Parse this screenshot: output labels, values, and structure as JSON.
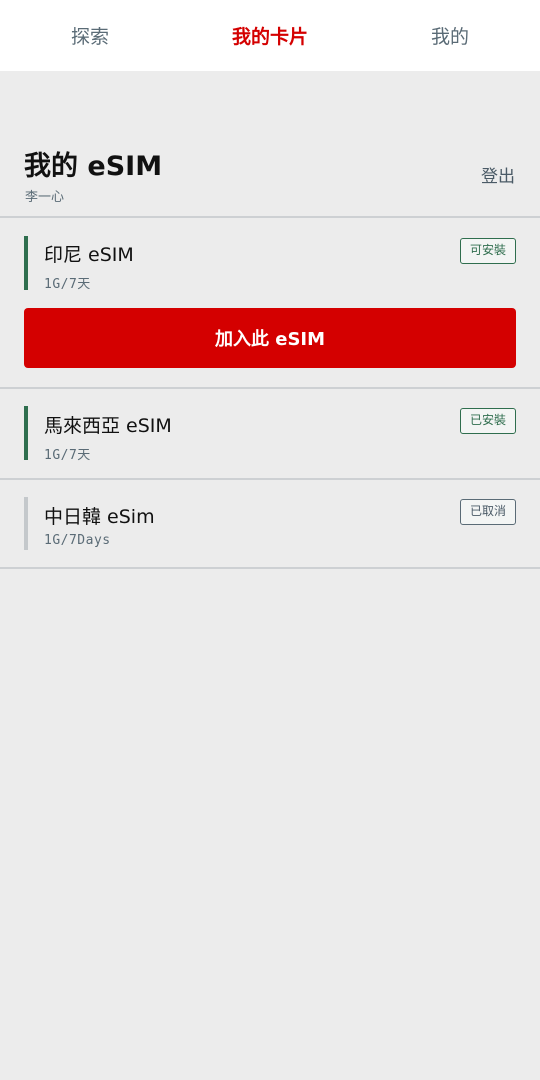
{
  "tabs": [
    {
      "label": "探索"
    },
    {
      "label": "我的卡片"
    },
    {
      "label": "我的"
    }
  ],
  "header": {
    "title": "我的 eSIM",
    "user": "李一心",
    "logout": "登出"
  },
  "cards": [
    {
      "name": "印尼 eSIM",
      "plan": "1G/7天",
      "status": "可安裝"
    },
    {
      "name": "馬來西亞 eSIM",
      "plan": "1G/7天",
      "status": "已安裝"
    },
    {
      "name": "中日韓 eSim",
      "plan": "1G/7Days",
      "status": "已取消"
    }
  ],
  "add_button": "加入此 eSIM",
  "colors": {
    "accent": "#d40000",
    "status_green": "#2f6e4e",
    "muted": "#5a6b76",
    "background": "#ececec"
  }
}
